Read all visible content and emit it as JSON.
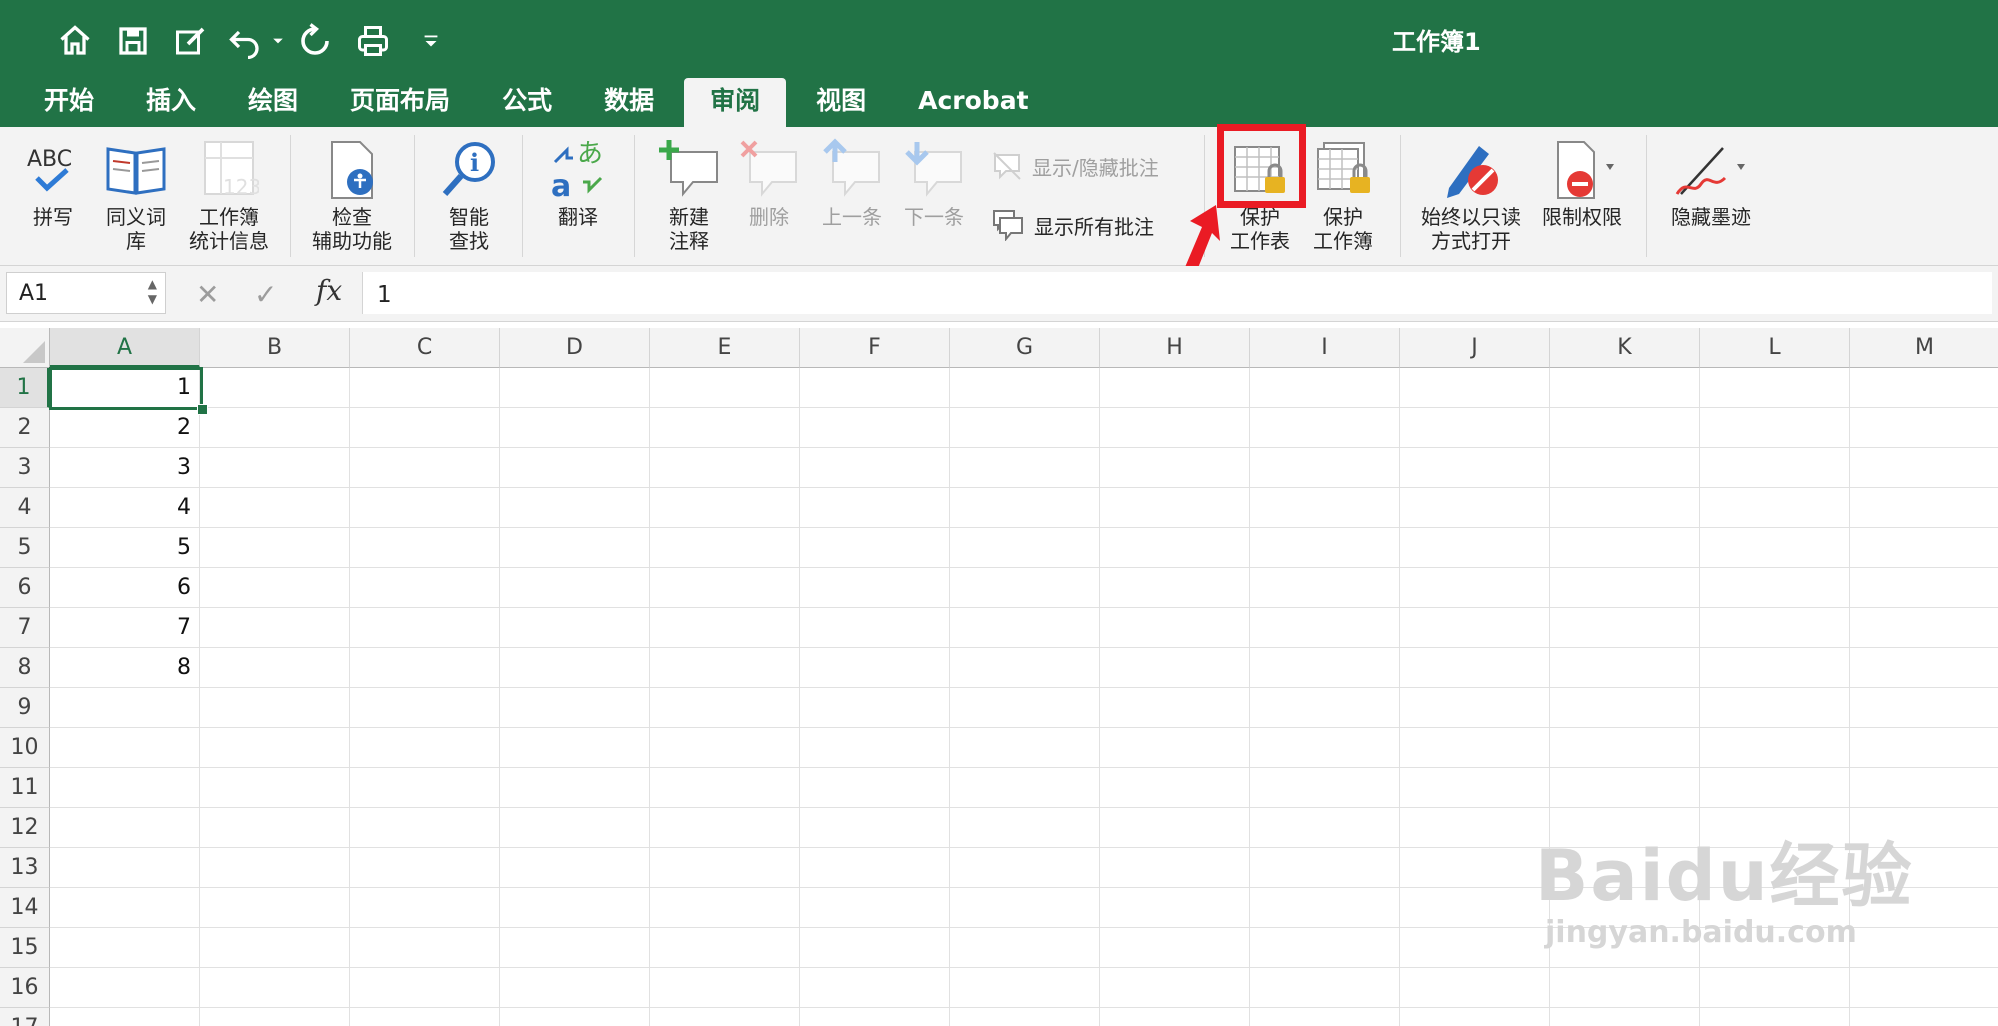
{
  "window": {
    "title": "工作簿1"
  },
  "quick_access": [
    "home-icon",
    "save-icon",
    "edit-icon",
    "undo-icon",
    "redo-icon",
    "print-icon",
    "customize-icon"
  ],
  "tabs": [
    {
      "label": "开始"
    },
    {
      "label": "插入"
    },
    {
      "label": "绘图"
    },
    {
      "label": "页面布局"
    },
    {
      "label": "公式"
    },
    {
      "label": "数据"
    },
    {
      "label": "审阅",
      "active": true
    },
    {
      "label": "视图"
    },
    {
      "label": "Acrobat"
    }
  ],
  "ribbon": {
    "spelling": "拼写",
    "thesaurus": [
      "同义词",
      "库"
    ],
    "workbook_stats": [
      "工作簿",
      "统计信息"
    ],
    "accessibility": [
      "检查",
      "辅助功能"
    ],
    "smart_lookup": [
      "智能",
      "查找"
    ],
    "translate": "翻译",
    "new_comment": [
      "新建",
      "注释"
    ],
    "delete": "删除",
    "previous": "上一条",
    "next": "下一条",
    "show_hide_comments": "显示/隐藏批注",
    "show_all_comments": "显示所有批注",
    "protect_sheet": [
      "保护",
      "工作表"
    ],
    "protect_workbook": [
      "保护",
      "工作簿"
    ],
    "always_open_readonly": [
      "始终以只读",
      "方式打开"
    ],
    "restrict_permission": "限制权限",
    "hide_ink": "隐藏墨迹"
  },
  "formula_bar": {
    "name_box": "A1",
    "fx": "fx",
    "value": "1"
  },
  "sheet": {
    "columns": [
      "A",
      "B",
      "C",
      "D",
      "E",
      "F",
      "G",
      "H",
      "I",
      "J",
      "K",
      "L",
      "M"
    ],
    "rows": [
      "1",
      "2",
      "3",
      "4",
      "5",
      "6",
      "7",
      "8",
      "9",
      "10",
      "11",
      "12",
      "13",
      "14",
      "15",
      "16",
      "17"
    ],
    "cells_A": [
      "1",
      "2",
      "3",
      "4",
      "5",
      "6",
      "7",
      "8"
    ]
  },
  "watermark": {
    "line1": "Baidu经验",
    "line2": "jingyan.baidu.com"
  },
  "colors": {
    "brand": "#217346",
    "highlight": "#ea1b24"
  }
}
